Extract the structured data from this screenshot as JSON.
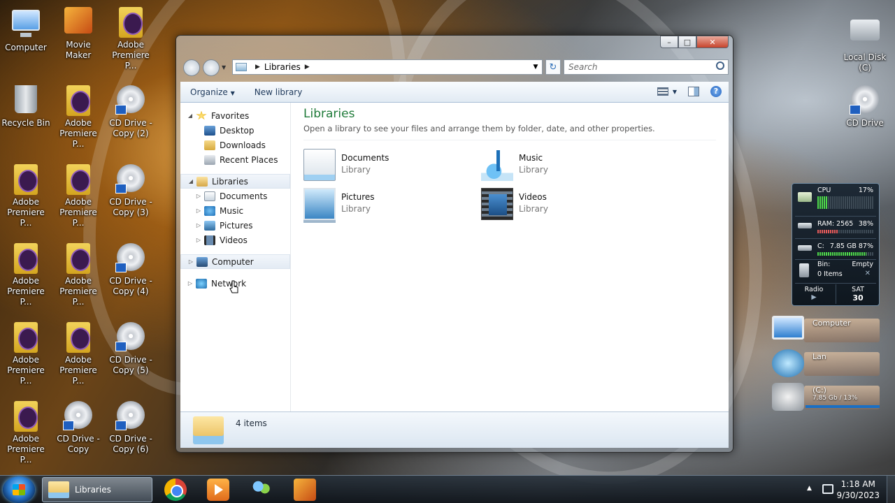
{
  "desktop": {
    "icons_col1": [
      "Computer",
      "Recycle Bin",
      "Adobe Premiere P...",
      "Adobe Premiere P...",
      "Adobe Premiere P...",
      "Adobe Premiere P..."
    ],
    "icons_col2": [
      "Movie Maker",
      "Adobe Premiere P...",
      "Adobe Premiere P...",
      "Adobe Premiere P...",
      "Adobe Premiere P...",
      "CD Drive - Copy"
    ],
    "icons_col3": [
      "Adobe Premiere P...",
      "CD Drive - Copy (2)",
      "CD Drive - Copy (3)",
      "CD Drive - Copy (4)",
      "CD Drive - Copy (5)",
      "CD Drive - Copy (6)"
    ],
    "icons_right": [
      "Local Disk (C)",
      "CD Drive"
    ]
  },
  "window": {
    "breadcrumb": "Libraries",
    "search_placeholder": "Search",
    "toolbar": {
      "organize": "Organize",
      "new_library": "New library"
    },
    "nav": {
      "favorites": "Favorites",
      "desktop": "Desktop",
      "downloads": "Downloads",
      "recent": "Recent Places",
      "libraries": "Libraries",
      "documents": "Documents",
      "music": "Music",
      "pictures": "Pictures",
      "videos": "Videos",
      "computer": "Computer",
      "network": "Network"
    },
    "main": {
      "title": "Libraries",
      "subtitle": "Open a library to see your files and arrange them by folder, date, and other properties.",
      "items": [
        {
          "name": "Documents",
          "type": "Library"
        },
        {
          "name": "Music",
          "type": "Library"
        },
        {
          "name": "Pictures",
          "type": "Library"
        },
        {
          "name": "Videos",
          "type": "Library"
        }
      ]
    },
    "details": {
      "count": "4 items"
    }
  },
  "gadget": {
    "cpu_label": "CPU",
    "cpu_value": "17%",
    "cpu_level": 0.17,
    "ram_label": "RAM: 2565",
    "ram_value": "38%",
    "ram_level": 0.38,
    "disk_label": "C:",
    "disk_value": "7.85 GB 87%",
    "disk_level": 0.87,
    "bin_label": "Bin:",
    "bin_state": "Empty",
    "bin_items": "0 Items",
    "radio_label": "Radio",
    "day": "SAT",
    "date": "30"
  },
  "cards": {
    "computer": "Computer",
    "lan": "Lan",
    "drive_label": "(C:)",
    "drive_info": "7.85 Gb / 13%"
  },
  "taskbar": {
    "active_task": "Libraries",
    "time": "1:18 AM",
    "date": "9/30/2023"
  }
}
